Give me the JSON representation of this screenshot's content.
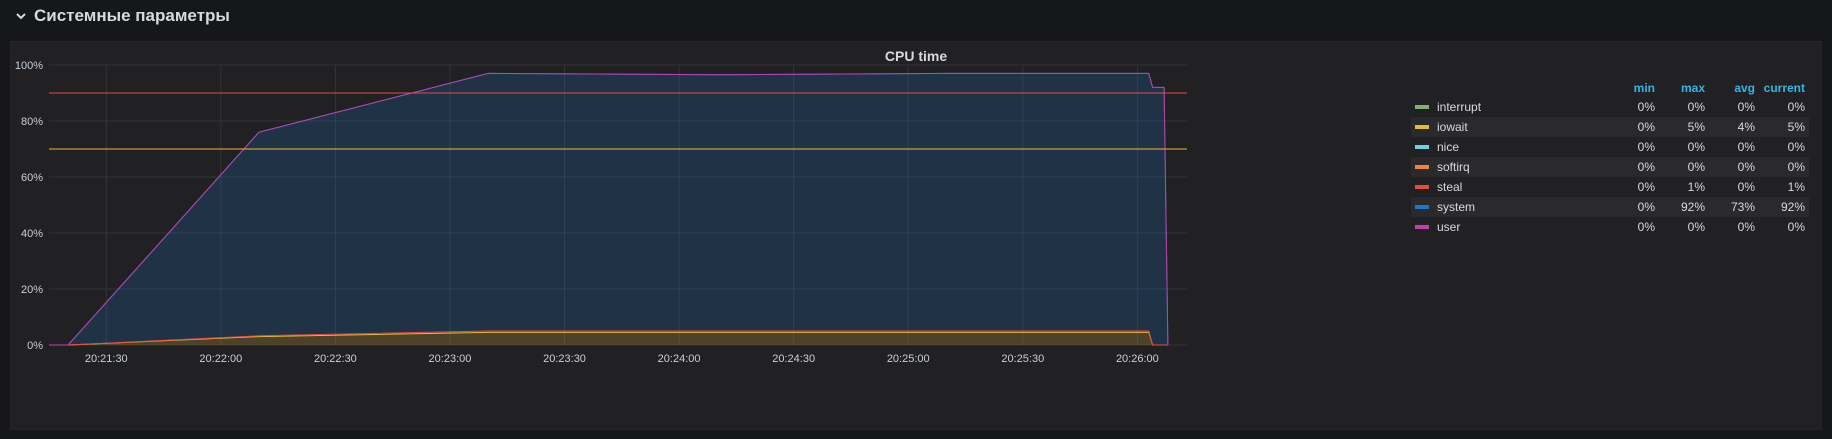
{
  "row": {
    "title": "Системные параметры"
  },
  "panel": {
    "title": "CPU time"
  },
  "legend": {
    "headers": {
      "min": "min",
      "max": "max",
      "avg": "avg",
      "current": "current"
    },
    "items": [
      {
        "name": "interrupt",
        "color": "#7eb26d",
        "min": "0%",
        "max": "0%",
        "avg": "0%",
        "current": "0%"
      },
      {
        "name": "iowait",
        "color": "#eab839",
        "min": "0%",
        "max": "5%",
        "avg": "4%",
        "current": "5%"
      },
      {
        "name": "nice",
        "color": "#6ed0e0",
        "min": "0%",
        "max": "0%",
        "avg": "0%",
        "current": "0%"
      },
      {
        "name": "softirq",
        "color": "#ef843c",
        "min": "0%",
        "max": "0%",
        "avg": "0%",
        "current": "0%"
      },
      {
        "name": "steal",
        "color": "#e24d42",
        "min": "0%",
        "max": "1%",
        "avg": "0%",
        "current": "1%"
      },
      {
        "name": "system",
        "color": "#1f78c1",
        "min": "0%",
        "max": "92%",
        "avg": "73%",
        "current": "92%"
      },
      {
        "name": "user",
        "color": "#ba43a9",
        "min": "0%",
        "max": "0%",
        "avg": "0%",
        "current": "0%"
      }
    ]
  },
  "chart_data": {
    "type": "area",
    "stacked": true,
    "title": "CPU time",
    "xlabel": "",
    "ylabel": "",
    "y_ticks": [
      "0%",
      "20%",
      "40%",
      "60%",
      "80%",
      "100%"
    ],
    "ylim": [
      0,
      100
    ],
    "x_tick_labels": [
      "20:21:30",
      "20:22:00",
      "20:22:30",
      "20:23:00",
      "20:23:30",
      "20:24:00",
      "20:24:30",
      "20:25:00",
      "20:25:30",
      "20:26:00"
    ],
    "x_range": [
      "20:21:15",
      "20:26:13"
    ],
    "grid": true,
    "legend_placement": "right",
    "thresholds": [
      {
        "value": 90,
        "color": "#e24d42"
      },
      {
        "value": 70,
        "color": "#eab839"
      }
    ],
    "x": [
      "20:21:15",
      "20:21:20",
      "20:22:10",
      "20:23:10",
      "20:24:10",
      "20:25:10",
      "20:26:03",
      "20:26:04",
      "20:26:05",
      "20:26:07",
      "20:26:08"
    ],
    "series": [
      {
        "name": "iowait",
        "color": "#eab839",
        "values": [
          0,
          0,
          3,
          4.5,
          4.5,
          4.5,
          4.5,
          0,
          0,
          0,
          0
        ]
      },
      {
        "name": "steal",
        "color": "#e24d42",
        "values": [
          0,
          0,
          0.3,
          0.5,
          0.5,
          0.5,
          0.5,
          0,
          0,
          0,
          0
        ]
      },
      {
        "name": "system",
        "color": "#1f78c1",
        "values": [
          0,
          0,
          72.7,
          92,
          91.5,
          92,
          92,
          92,
          92,
          92,
          0
        ]
      }
    ]
  }
}
